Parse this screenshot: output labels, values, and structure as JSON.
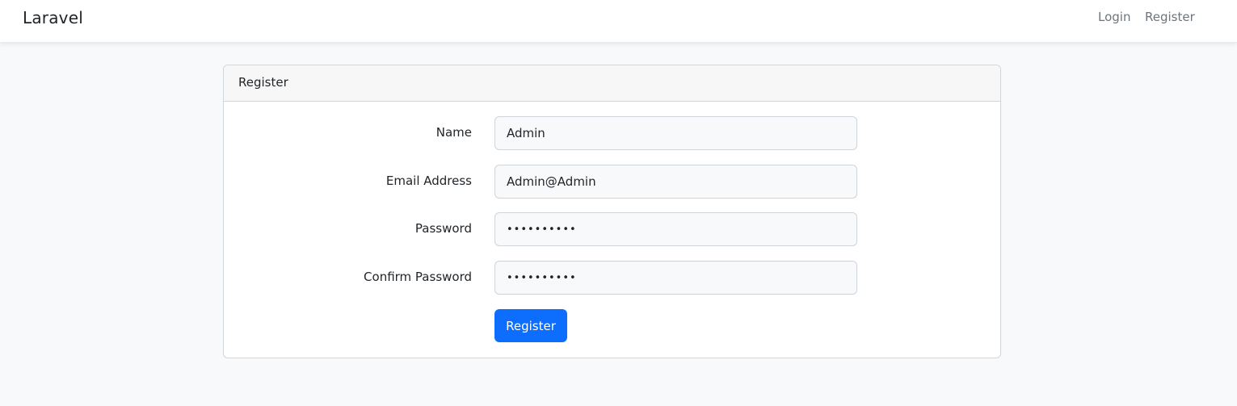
{
  "navbar": {
    "brand": "Laravel",
    "links": {
      "login": "Login",
      "register": "Register"
    }
  },
  "card": {
    "header": "Register",
    "fields": {
      "name": {
        "label": "Name",
        "value": "Admin"
      },
      "email": {
        "label": "Email Address",
        "value": "Admin@Admin"
      },
      "password": {
        "label": "Password",
        "value": "••••••••••"
      },
      "confirm": {
        "label": "Confirm Password",
        "value": "••••••••••"
      }
    },
    "submit_label": "Register"
  },
  "colors": {
    "primary": "#0d6efd",
    "background": "#f8f9fa"
  }
}
